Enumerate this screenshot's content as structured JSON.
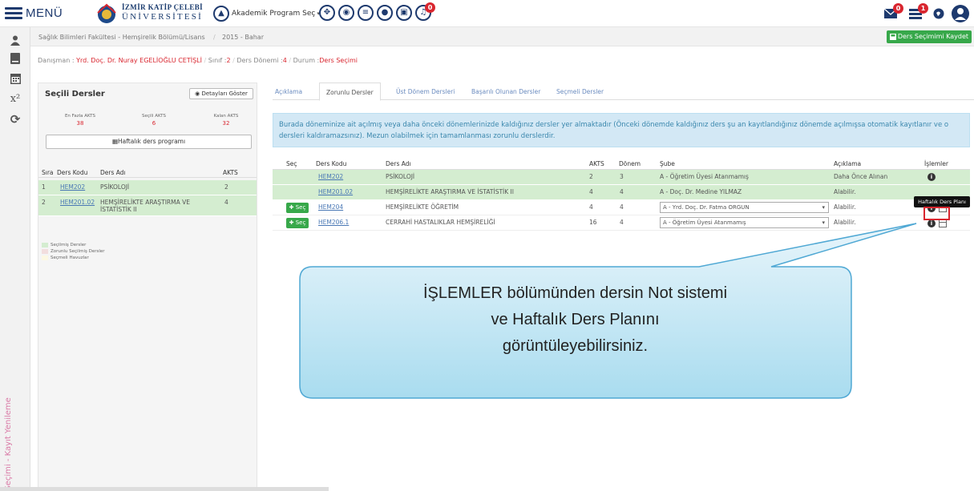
{
  "header": {
    "menu_label": "MENÜ",
    "university_line1": "İZMİR KATİP ÇELEBİ",
    "university_line2": "ÜNİVERSİTESİ",
    "program_select": "Akademik Program Seç",
    "mail_badge": "0",
    "list_badge": "1",
    "bell_badge": "0"
  },
  "sidebar": {
    "icons": [
      "user-icon",
      "book-icon",
      "calendar-icon",
      "superscript-icon",
      "refresh-icon"
    ],
    "vertical_label": "Ders Seçimi - Kayıt Yenileme"
  },
  "breadcrumb": {
    "path": "Sağlık Bilimleri Fakültesi - Hemşirelik Bölümü/Lisans",
    "sep": "/",
    "term": "2015 - Bahar"
  },
  "save_button": "Ders Seçimimi Kaydet",
  "info": {
    "advisor_label": "Danışman :",
    "advisor": "Yrd. Doç. Dr. Nuray EGELİOĞLU CETİŞLİ",
    "sep": "/",
    "class_label": "Sınıf :",
    "class_value": "2",
    "period_label": "Ders Dönemi :",
    "period_value": "4",
    "status_label": "Durum :",
    "status_value": "Ders Seçimi"
  },
  "selected": {
    "title": "Seçili Dersler",
    "detail_button": "Detayları Göster",
    "stats": [
      {
        "label": "En Fazla AKTS",
        "value": "38"
      },
      {
        "label": "Seçili AKTS",
        "value": "6"
      },
      {
        "label": "Kalan AKTS",
        "value": "32"
      }
    ],
    "schedule_button": "Haftalık ders programı",
    "headers": {
      "order": "Sıra",
      "code": "Ders Kodu",
      "name": "Ders Adı",
      "akts": "AKTS"
    },
    "rows": [
      {
        "order": "1",
        "code": "HEM202",
        "name": "PSİKOLOJİ",
        "akts": "2"
      },
      {
        "order": "2",
        "code": "HEM201.02",
        "name": "HEMŞİRELİKTE ARAŞTIRMA VE İSTATİSTİK II",
        "akts": "4"
      }
    ],
    "legend": [
      {
        "label": "Seçilmiş Dersler",
        "color": "#d4edd0"
      },
      {
        "label": "Zorunlu Seçilmiş Dersler",
        "color": "#f2dede"
      },
      {
        "label": "Seçmeli Havuzlar",
        "color": "#fcf8e3"
      }
    ]
  },
  "tabs": [
    "Açıklama",
    "Zorunlu Dersler",
    "Üst Dönem Dersleri",
    "Başarılı Olunan Dersler",
    "Seçmeli Dersler"
  ],
  "alert": "Burada döneminize ait açılmış veya daha önceki dönemlerinizde kaldığınız dersler yer almaktadır (Önceki dönemde kaldığınız ders şu an kayıtlandığınız dönemde açılmışsa otomatik kayıtlanır ve o dersleri kaldıramazsınız). Mezun olabilmek için tamamlanması zorunlu derslerdir.",
  "table": {
    "headers": {
      "sec": "Seç",
      "code": "Ders Kodu",
      "name": "Ders Adı",
      "akts": "AKTS",
      "term": "Dönem",
      "branch": "Şube",
      "note": "Açıklama",
      "actions": "İşlemler"
    },
    "select_label": "Seç",
    "rows": [
      {
        "code": "HEM202",
        "name": "PSİKOLOJİ",
        "akts": "2",
        "term": "3",
        "branch": "A - Öğretim Üyesi Atanmamış",
        "note": "Daha Önce Alınan"
      },
      {
        "code": "HEM201.02",
        "name": "HEMŞİRELİKTE ARAŞTIRMA VE İSTATİSTİK II",
        "akts": "4",
        "term": "4",
        "branch": "A - Doç. Dr. Medine YILMAZ",
        "note": "Alabilir."
      },
      {
        "code": "HEM204",
        "name": "HEMŞİRELİKTE ÖĞRETİM",
        "akts": "4",
        "term": "4",
        "branch": "A - Yrd. Doç. Dr. Fatma ORGUN",
        "note": "Alabilir."
      },
      {
        "code": "HEM206.1",
        "name": "CERRAHİ HASTALIKLAR HEMŞİRELİĞİ",
        "akts": "16",
        "term": "4",
        "branch": "A - Öğretim Üyesi Atanmamış",
        "note": "Alabilir."
      }
    ]
  },
  "tooltip": "Haftalık Ders Planı",
  "callout": {
    "line1": "İŞLEMLER bölümünden dersin Not sistemi",
    "line2": "ve Haftalık Ders Planını",
    "line3": "görüntüleyebilirsiniz."
  }
}
